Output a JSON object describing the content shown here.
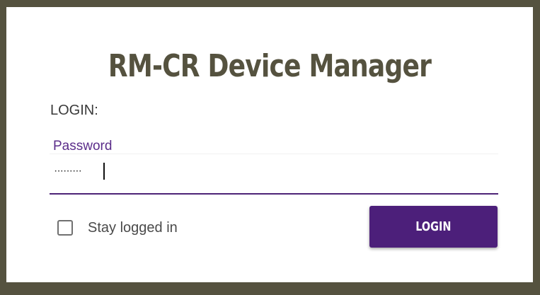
{
  "dialog": {
    "title": "RM-CR Device Manager",
    "login_heading": "LOGIN:"
  },
  "password": {
    "label": "Password",
    "masked_value": "·········"
  },
  "stay_logged_in": {
    "label": "Stay logged in",
    "checked": false
  },
  "login_button": {
    "label": "LOGIN"
  },
  "colors": {
    "frame": "#55523f",
    "accent": "#4c1f7a",
    "title": "#55523f"
  }
}
